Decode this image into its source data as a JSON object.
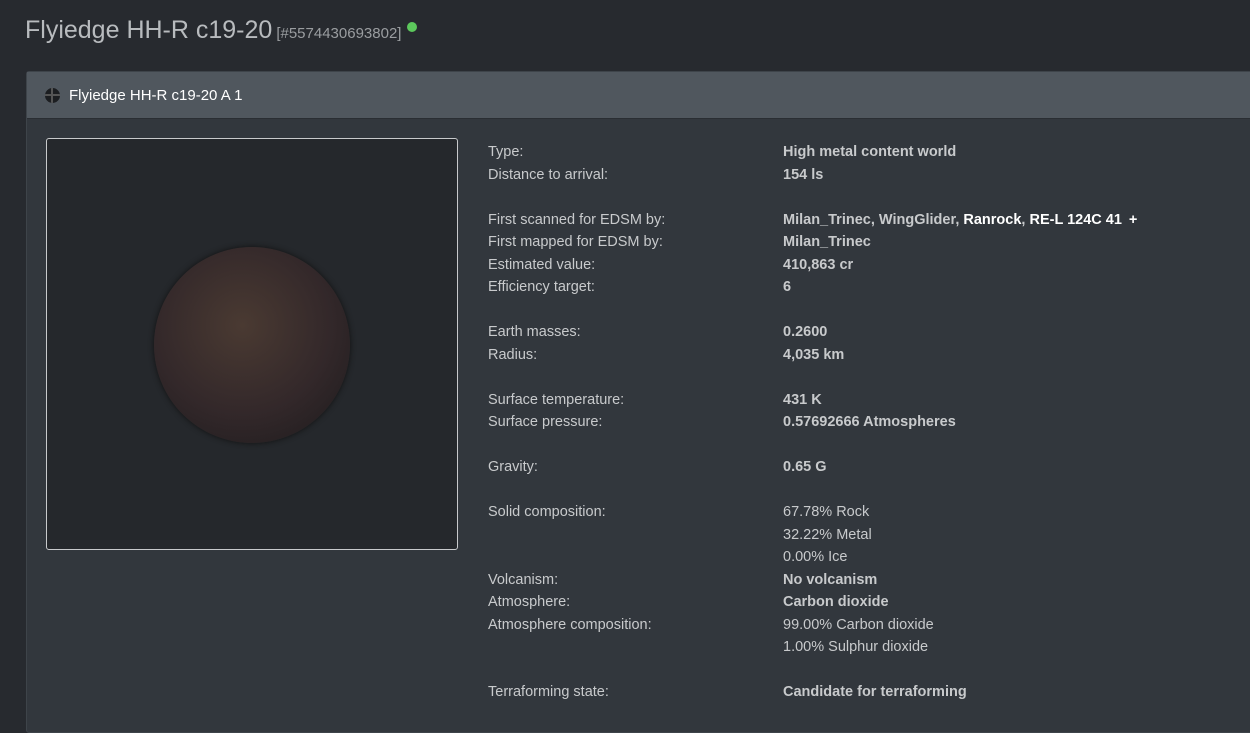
{
  "header": {
    "title": "Flyiedge HH-R c19-20",
    "id": "[#5574430693802]"
  },
  "body": {
    "name": "Flyiedge HH-R c19-20 A 1",
    "type_label": "Type:",
    "type": "High metal content world",
    "distance_label": "Distance to arrival:",
    "distance": "154 ls",
    "scanned_label": "First scanned for EDSM by:",
    "scanned_by": [
      "Milan_Trinec",
      "WingGlider",
      "Ranrock",
      "RE-L 124C 41"
    ],
    "scanned_more": "+",
    "mapped_label": "First mapped for EDSM by:",
    "mapped_by": "Milan_Trinec",
    "value_label": "Estimated value:",
    "value": "410,863 cr",
    "eff_label": "Efficiency target:",
    "eff": "6",
    "mass_label": "Earth masses:",
    "mass": "0.2600",
    "radius_label": "Radius:",
    "radius": "4,035 km",
    "temp_label": "Surface temperature:",
    "temp": "431 K",
    "pressure_label": "Surface pressure:",
    "pressure": "0.57692666 Atmospheres",
    "gravity_label": "Gravity:",
    "gravity": "0.65 G",
    "solid_label": "Solid composition:",
    "solid": [
      "67.78% Rock",
      "32.22% Metal",
      "0.00% Ice"
    ],
    "volc_label": "Volcanism:",
    "volc": "No volcanism",
    "atmo_label": "Atmosphere:",
    "atmo": "Carbon dioxide",
    "atmocomp_label": "Atmosphere composition:",
    "atmocomp": [
      "99.00% Carbon dioxide",
      "1.00% Sulphur dioxide"
    ],
    "terra_label": "Terraforming state:",
    "terra": "Candidate for terraforming"
  }
}
